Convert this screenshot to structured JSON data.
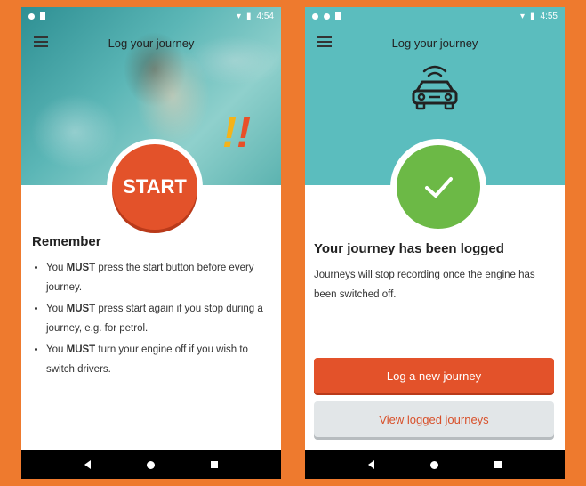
{
  "phone1": {
    "status": {
      "time": "4:54"
    },
    "appbar": {
      "title": "Log your journey"
    },
    "hero": {
      "exclaim": "!!"
    },
    "start_label": "START",
    "remember": {
      "heading": "Remember",
      "items": [
        {
          "pre": "You ",
          "bold": "MUST",
          "post": " press the start button before every journey."
        },
        {
          "pre": "You ",
          "bold": "MUST",
          "post": " press start again if you stop during a journey, e.g. for petrol."
        },
        {
          "pre": "You ",
          "bold": "MUST",
          "post": " turn your engine off if you wish to switch drivers."
        }
      ]
    }
  },
  "phone2": {
    "status": {
      "time": "4:55"
    },
    "appbar": {
      "title": "Log your journey"
    },
    "logged_title": "Your journey has been logged",
    "logged_desc": "Journeys will stop recording once the engine has been switched off.",
    "buttons": {
      "new_journey": "Log a new journey",
      "view_logged": "View logged journeys"
    }
  },
  "colors": {
    "background": "#EE7A2E",
    "teal": "#5BBDBE",
    "accent": "#E3522A",
    "success": "#6CB946"
  }
}
